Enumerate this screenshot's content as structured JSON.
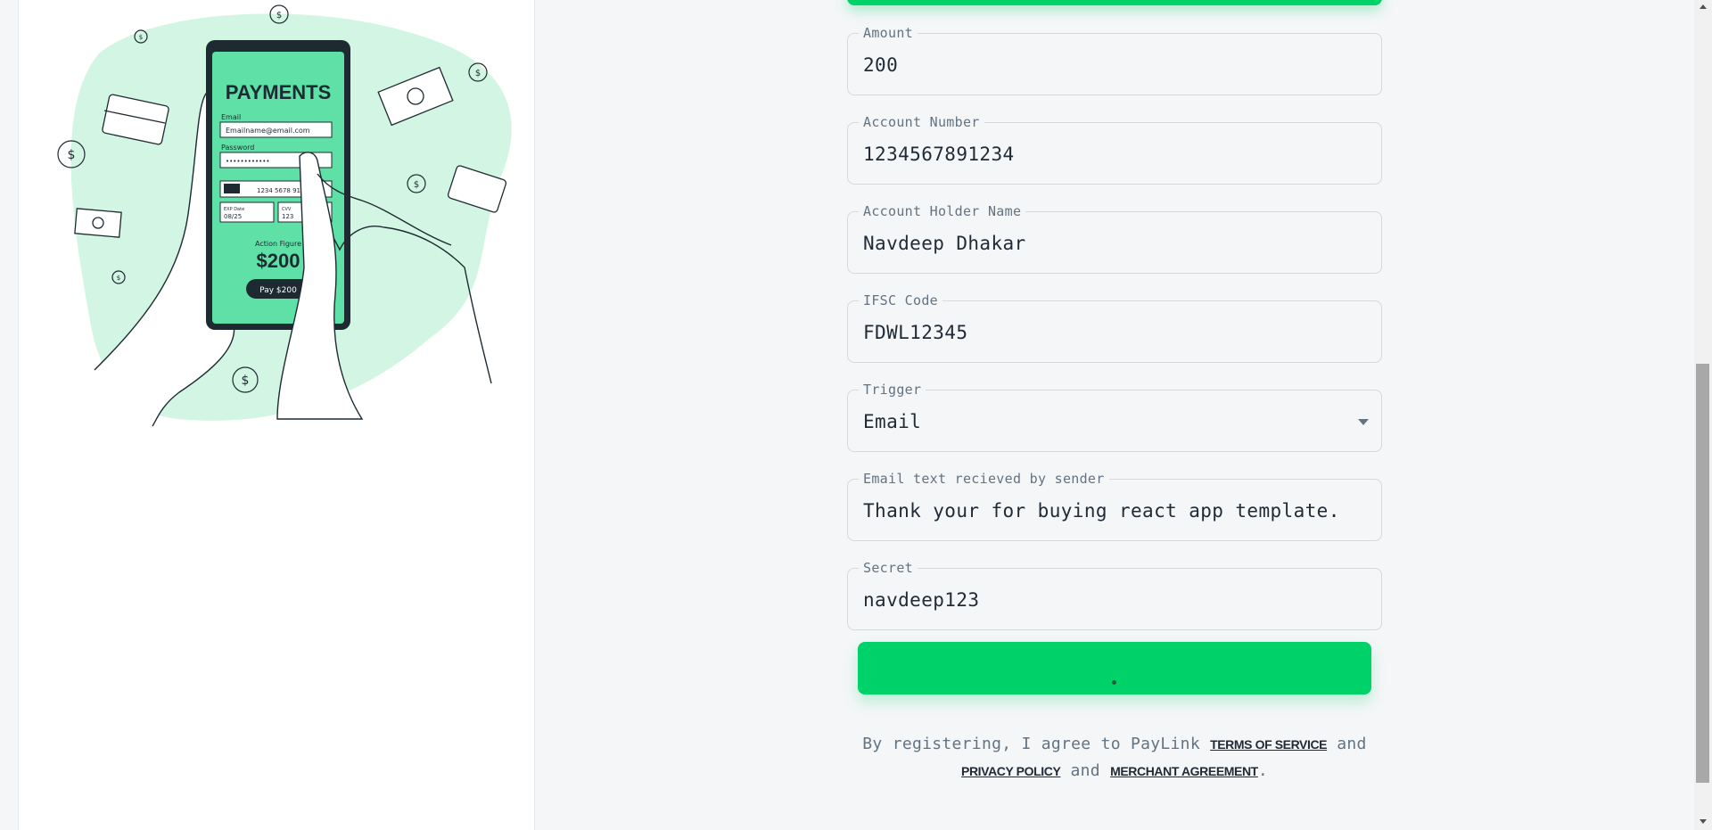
{
  "illustration": {
    "title": "PAYMENTS",
    "email_label": "Email",
    "email_value": "Emailname@email.com",
    "password_label": "Password",
    "password_value": "••••••••••••",
    "card_number": "1234 5678 9101",
    "exp_label": "EXP Date",
    "exp_value": "08/25",
    "cvv_label": "CVV",
    "cvv_value": "123",
    "action_label": "Action Figure",
    "amount": "$200",
    "pay_button": "Pay $200",
    "colors": {
      "mint": "#d2f5e4",
      "green": "#5fe0a6",
      "dark": "#1e2a32"
    }
  },
  "form": {
    "fields": [
      {
        "label": "Amount",
        "value": "200"
      },
      {
        "label": "Account Number",
        "value": "1234567891234"
      },
      {
        "label": "Account Holder Name",
        "value": "Navdeep Dhakar"
      },
      {
        "label": "IFSC Code",
        "value": "FDWL12345"
      },
      {
        "label": "Trigger",
        "value": "Email"
      },
      {
        "label": "Email text recieved by sender",
        "value": "Thank your for buying react app template."
      },
      {
        "label": "Secret",
        "value": "navdeep123"
      }
    ],
    "submit_state": "loading",
    "accent_color": "#00d26a"
  },
  "terms": {
    "prefix": "By registering, I agree to PayLink",
    "link_terms": "Terms of Service",
    "and1": "and",
    "link_privacy": "Privacy Policy",
    "and2": "and",
    "link_merchant": "Merchant Agreement",
    "suffix": "."
  }
}
